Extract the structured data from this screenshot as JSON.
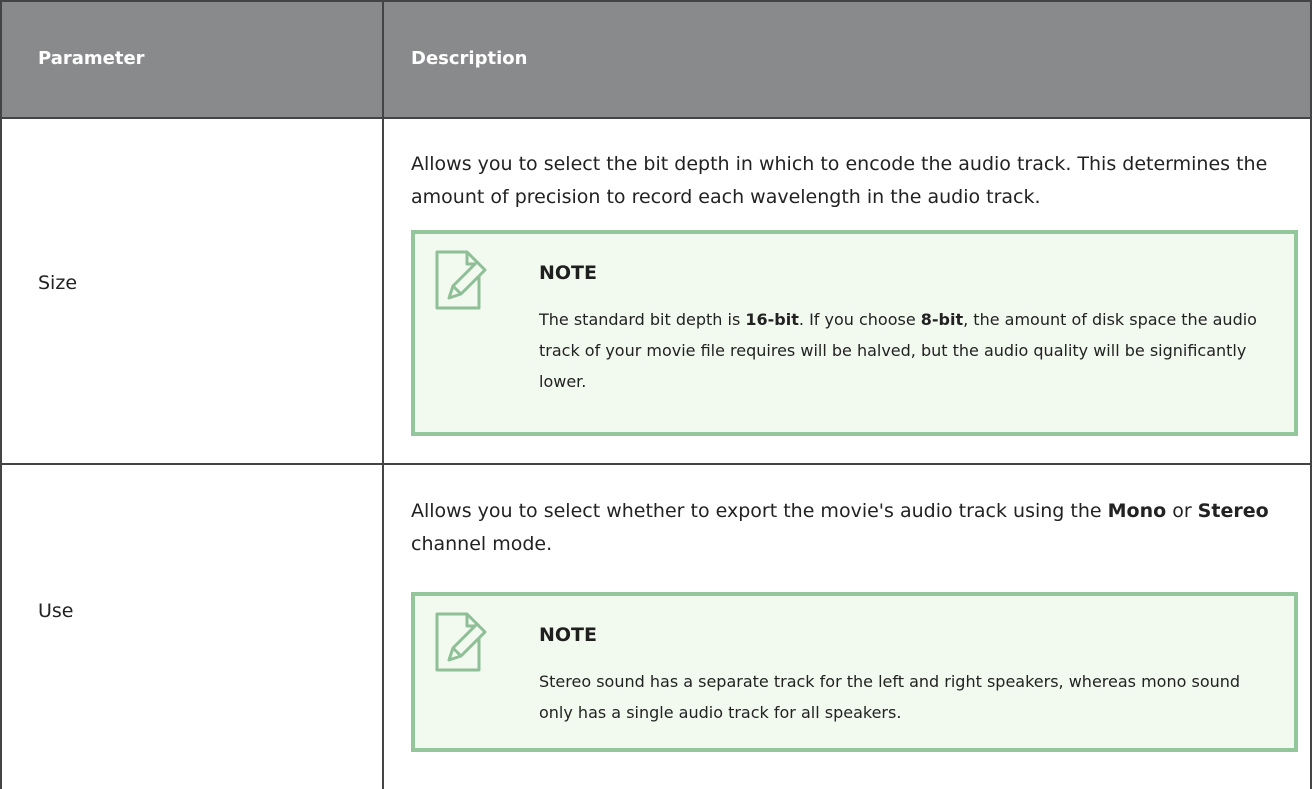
{
  "table": {
    "headers": {
      "parameter": "Parameter",
      "description": "Description"
    },
    "rows": [
      {
        "parameter": "Size",
        "description": "Allows you to select the bit depth in which to encode the audio track. This determines the amount of precision to record each wavelength in the audio track.",
        "note": {
          "title": "NOTE",
          "body_parts": [
            "The standard bit depth is ",
            "16-bit",
            ". If you choose ",
            "8-bit",
            ", the amount of disk space the audio track of your movie file requires will be halved, but the audio quality will be significantly lower."
          ]
        }
      },
      {
        "parameter": "Use",
        "description_parts": [
          "Allows you to select whether to export the movie's audio track using the ",
          "Mono",
          " or ",
          "Stereo",
          " channel mode."
        ],
        "note": {
          "title": "NOTE",
          "body": "Stereo sound has a separate track for the left and right speakers, whereas mono sound only has a single audio track for all speakers."
        }
      }
    ]
  },
  "icons": {
    "note": "note-pencil-icon"
  },
  "colors": {
    "header_bg": "#898a8c",
    "note_bg": "#f2faef",
    "note_border": "#93c79b"
  }
}
